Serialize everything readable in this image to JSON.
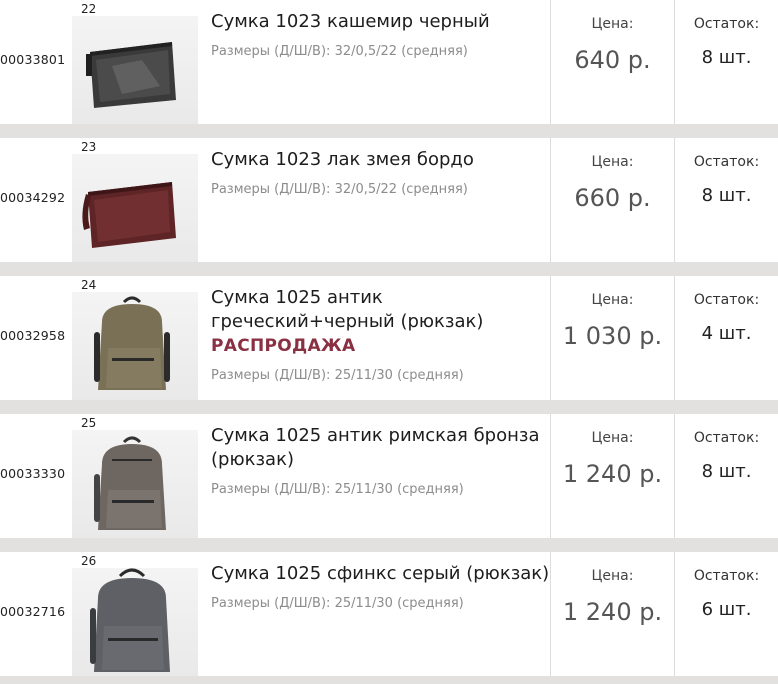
{
  "labels": {
    "price": "Цена:",
    "stock": "Остаток:"
  },
  "products": [
    {
      "index": "22",
      "sku": "00033801",
      "title": "Сумка 1023 кашемир черный",
      "sale": "",
      "dims": "Размеры (Д/Ш/В): 32/0,5/22 (средняя)",
      "price": "640 р.",
      "stock": "8 шт.",
      "photo": "black-clutch-bag"
    },
    {
      "index": "23",
      "sku": "00034292",
      "title": "Сумка 1023 лак змея бордо",
      "sale": "",
      "dims": "Размеры (Д/Ш/В): 32/0,5/22 (средняя)",
      "price": "660 р.",
      "stock": "8 шт.",
      "photo": "burgundy-clutch-bag"
    },
    {
      "index": "24",
      "sku": "00032958",
      "title": "Сумка 1025 антик греческий+черный (рюкзак)",
      "sale": "РАСПРОДАЖА",
      "dims": "Размеры (Д/Ш/В): 25/11/30 (средняя)",
      "price": "1 030 р.",
      "stock": "4 шт.",
      "photo": "olive-backpack"
    },
    {
      "index": "25",
      "sku": "00033330",
      "title": "Сумка 1025 антик римская бронза (рюкзак)",
      "sale": "",
      "dims": "Размеры (Д/Ш/В): 25/11/30 (средняя)",
      "price": "1 240 р.",
      "stock": "8 шт.",
      "photo": "bronze-backpack"
    },
    {
      "index": "26",
      "sku": "00032716",
      "title": "Сумка 1025 сфинкс серый (рюкзак)",
      "sale": "",
      "dims": "Размеры (Д/Ш/В): 25/11/30 (средняя)",
      "price": "1 240 р.",
      "stock": "6 шт.",
      "photo": "gray-backpack"
    }
  ]
}
